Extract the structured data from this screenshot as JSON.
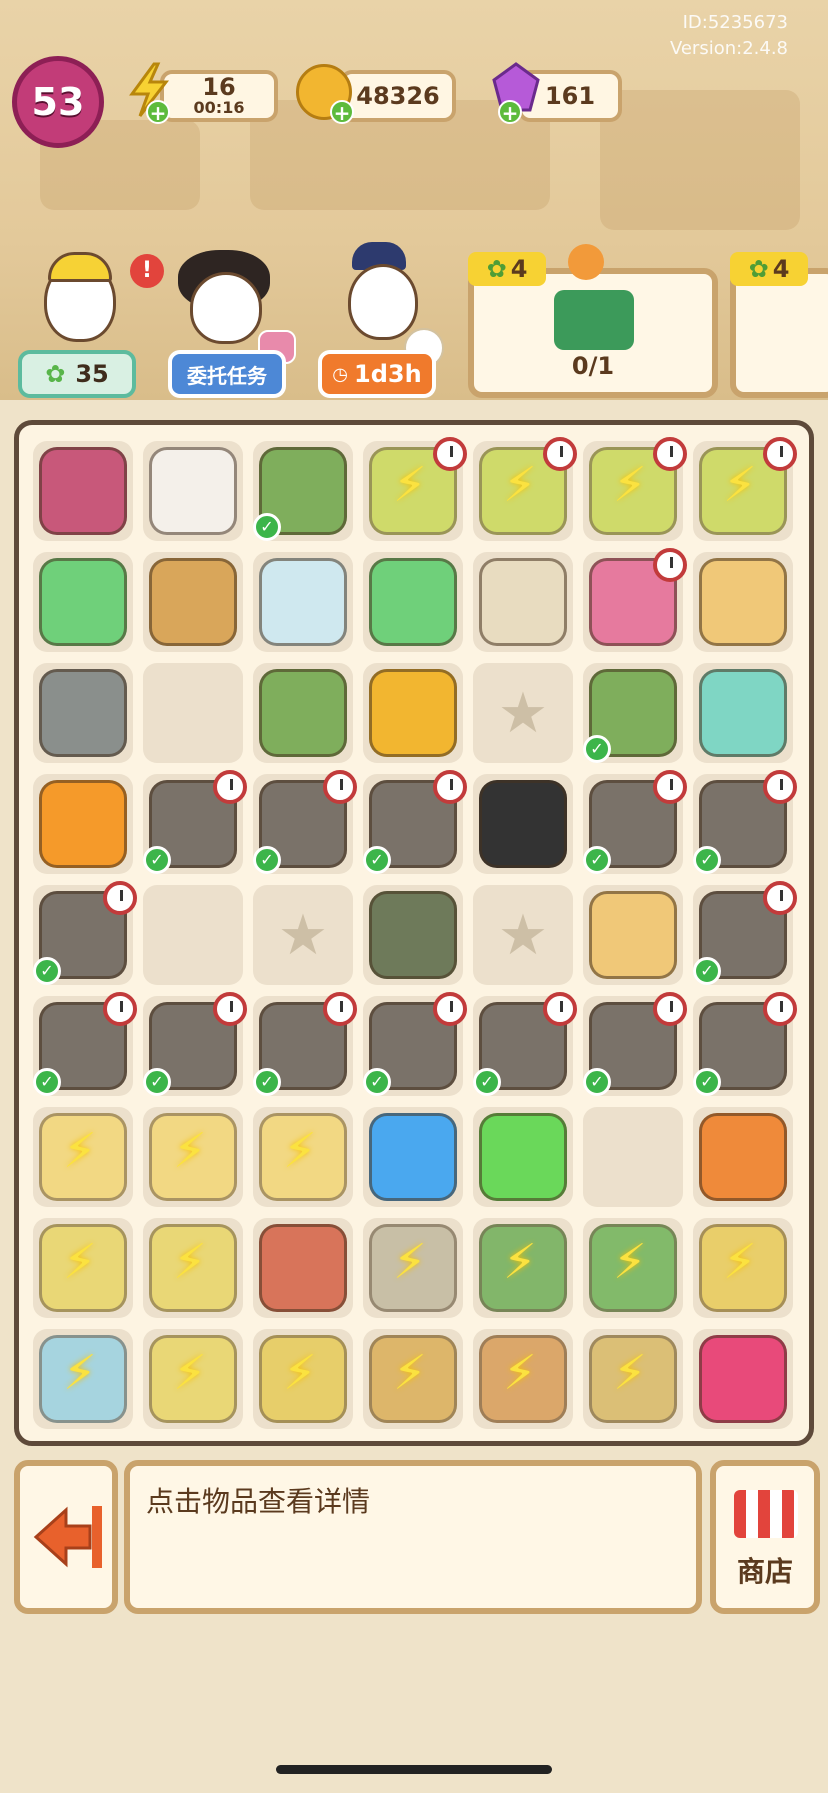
{
  "header": {
    "id_text": "ID:5235673",
    "version_text": "Version:2.4.8",
    "level": "53",
    "energy": {
      "value": "16",
      "timer": "00:16"
    },
    "coins": {
      "value": "48326"
    },
    "gems": {
      "value": "161"
    }
  },
  "characters": [
    {
      "badge": "35"
    },
    {
      "badge": "委托任务"
    },
    {
      "badge": "1d3h"
    }
  ],
  "orders": [
    {
      "tag": "4",
      "progress": "0/1"
    },
    {
      "tag": "4"
    }
  ],
  "info_text": "点击物品查看详情",
  "shop_label": "商店",
  "colors": {
    "accent": "#c23c78",
    "board_border": "#5e4a3a",
    "check": "#3cb54a"
  }
}
